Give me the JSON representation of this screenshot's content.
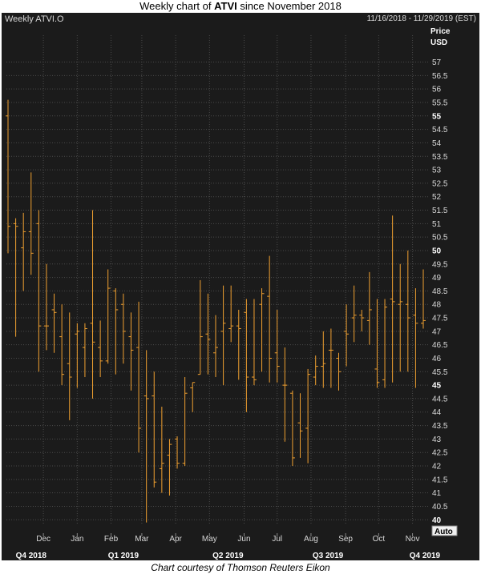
{
  "header": {
    "title_prefix": "Weekly chart of ",
    "title_ticker": "ATVI",
    "title_suffix": " since November 2018",
    "instrument": "Weekly ATVI.O",
    "date_range": "11/16/2018 - 11/29/2019 (EST)",
    "price_label": "Price",
    "currency_label": "USD",
    "scale_mode": "Auto",
    "credit": "Chart courtesy of Thomson Reuters Eikon"
  },
  "colors": {
    "background": "#1b1b1b",
    "bar": "#f0a030",
    "grid": "#4a4a4a",
    "text": "#d8d8d8"
  },
  "chart_data": {
    "type": "ohlc",
    "ylim": [
      39.8,
      57.7
    ],
    "grid": true,
    "yticks": [
      40,
      40.5,
      41,
      41.5,
      42,
      42.5,
      43,
      43.5,
      44,
      44.5,
      45,
      45.5,
      46,
      46.5,
      47,
      47.5,
      48,
      48.5,
      49,
      49.5,
      50,
      50.5,
      51,
      51.5,
      52,
      52.5,
      53,
      53.5,
      54,
      54.5,
      55,
      55.5,
      56,
      56.5,
      57
    ],
    "yticks_bold": [
      40,
      45,
      50,
      55
    ],
    "month_labels": [
      {
        "label": "Dec",
        "week": 4.6
      },
      {
        "label": "Jan",
        "week": 9.0
      },
      {
        "label": "Feb",
        "week": 13.4
      },
      {
        "label": "Mar",
        "week": 17.4
      },
      {
        "label": "Apr",
        "week": 21.8
      },
      {
        "label": "May",
        "week": 26.2
      },
      {
        "label": "Jun",
        "week": 30.7
      },
      {
        "label": "Jul",
        "week": 35.0
      },
      {
        "label": "Aug",
        "week": 39.4
      },
      {
        "label": "Sep",
        "week": 43.9
      },
      {
        "label": "Oct",
        "week": 48.2
      },
      {
        "label": "Nov",
        "week": 52.6
      }
    ],
    "quarter_labels": [
      {
        "label": "Q4 2018",
        "week": 3.0
      },
      {
        "label": "Q1 2019",
        "week": 15.0
      },
      {
        "label": "Q2 2019",
        "week": 28.6
      },
      {
        "label": "Q3 2019",
        "week": 41.6
      },
      {
        "label": "Q4 2019",
        "week": 54.2
      }
    ],
    "week_count": 55,
    "bars": [
      {
        "o": 55.0,
        "h": 55.6,
        "l": 49.9,
        "c": 50.9
      },
      {
        "o": 51.0,
        "h": 51.2,
        "l": 46.8,
        "c": 50.9
      },
      {
        "o": 50.1,
        "h": 51.4,
        "l": 48.5,
        "c": 50.7
      },
      {
        "o": 50.7,
        "h": 52.9,
        "l": 49.1,
        "c": 49.9
      },
      {
        "o": 51.0,
        "h": 51.5,
        "l": 45.5,
        "c": 47.2
      },
      {
        "o": 47.2,
        "h": 49.5,
        "l": 46.3,
        "c": 47.2
      },
      {
        "o": 47.8,
        "h": 48.4,
        "l": 46.2,
        "c": 47.7
      },
      {
        "o": 46.8,
        "h": 48.0,
        "l": 45.0,
        "c": 45.4
      },
      {
        "o": 45.8,
        "h": 47.7,
        "l": 43.7,
        "c": 45.3
      },
      {
        "o": 46.9,
        "h": 47.3,
        "l": 44.9,
        "c": 47.0
      },
      {
        "o": 46.4,
        "h": 47.3,
        "l": 45.3,
        "c": 47.1
      },
      {
        "o": 47.3,
        "h": 51.5,
        "l": 44.5,
        "c": 46.6
      },
      {
        "o": 46.4,
        "h": 47.4,
        "l": 45.3,
        "c": 45.9
      },
      {
        "o": 45.9,
        "h": 49.3,
        "l": 45.8,
        "c": 48.6
      },
      {
        "o": 48.5,
        "h": 48.6,
        "l": 45.4,
        "c": 47.8
      },
      {
        "o": 48.0,
        "h": 48.4,
        "l": 45.8,
        "c": 47.0
      },
      {
        "o": 46.8,
        "h": 47.7,
        "l": 44.8,
        "c": 46.3
      },
      {
        "o": 46.4,
        "h": 48.1,
        "l": 42.5,
        "c": 43.4
      },
      {
        "o": 44.6,
        "h": 46.3,
        "l": 39.9,
        "c": 44.5
      },
      {
        "o": 44.6,
        "h": 45.5,
        "l": 41.2,
        "c": 41.4
      },
      {
        "o": 41.9,
        "h": 44.2,
        "l": 41.0,
        "c": 42.1
      },
      {
        "o": 42.4,
        "h": 43.0,
        "l": 40.9,
        "c": 42.8
      },
      {
        "o": 43.0,
        "h": 43.1,
        "l": 41.9,
        "c": 42.1
      },
      {
        "o": 42.1,
        "h": 45.3,
        "l": 42.0,
        "c": 44.7
      },
      {
        "o": 44.9,
        "h": 45.1,
        "l": 44.0,
        "c": 45.1
      },
      {
        "o": 45.4,
        "h": 48.9,
        "l": 45.4,
        "c": 46.8
      },
      {
        "o": 46.9,
        "h": 48.4,
        "l": 45.4,
        "c": 46.7
      },
      {
        "o": 46.2,
        "h": 47.6,
        "l": 45.3,
        "c": 46.4
      },
      {
        "o": 47.0,
        "h": 48.7,
        "l": 45.0,
        "c": 47.3
      },
      {
        "o": 47.1,
        "h": 48.7,
        "l": 46.6,
        "c": 47.2
      },
      {
        "o": 47.2,
        "h": 47.8,
        "l": 45.2,
        "c": 47.1
      },
      {
        "o": 47.7,
        "h": 48.2,
        "l": 44.0,
        "c": 45.3
      },
      {
        "o": 45.3,
        "h": 48.2,
        "l": 45.0,
        "c": 45.2
      },
      {
        "o": 48.0,
        "h": 48.6,
        "l": 45.5,
        "c": 48.4
      },
      {
        "o": 48.3,
        "h": 49.8,
        "l": 45.1,
        "c": 46.0
      },
      {
        "o": 46.2,
        "h": 47.8,
        "l": 45.1,
        "c": 45.7
      },
      {
        "o": 45.0,
        "h": 46.4,
        "l": 42.9,
        "c": 45.0
      },
      {
        "o": 44.7,
        "h": 44.8,
        "l": 42.0,
        "c": 42.3
      },
      {
        "o": 43.6,
        "h": 44.7,
        "l": 42.3,
        "c": 43.3
      },
      {
        "o": 43.4,
        "h": 45.6,
        "l": 42.1,
        "c": 45.4
      },
      {
        "o": 45.3,
        "h": 46.1,
        "l": 45.0,
        "c": 45.7
      },
      {
        "o": 45.7,
        "h": 47.0,
        "l": 44.9,
        "c": 45.8
      },
      {
        "o": 46.3,
        "h": 47.1,
        "l": 44.9,
        "c": 46.3
      },
      {
        "o": 46.0,
        "h": 46.2,
        "l": 44.8,
        "c": 45.5
      },
      {
        "o": 47.0,
        "h": 48.0,
        "l": 45.7,
        "c": 46.9
      },
      {
        "o": 47.5,
        "h": 48.7,
        "l": 46.6,
        "c": 47.6
      },
      {
        "o": 47.6,
        "h": 47.8,
        "l": 47.0,
        "c": 47.5
      },
      {
        "o": 47.4,
        "h": 49.2,
        "l": 46.5,
        "c": 47.8
      },
      {
        "o": 45.6,
        "h": 48.2,
        "l": 44.9,
        "c": 45.1
      },
      {
        "o": 45.2,
        "h": 48.2,
        "l": 44.9,
        "c": 47.9
      },
      {
        "o": 48.2,
        "h": 51.3,
        "l": 45.1,
        "c": 48.1
      },
      {
        "o": 48.0,
        "h": 49.5,
        "l": 45.5,
        "c": 48.1
      },
      {
        "o": 48.0,
        "h": 50.0,
        "l": 45.5,
        "c": 47.5
      },
      {
        "o": 47.6,
        "h": 48.6,
        "l": 44.9,
        "c": 47.3
      },
      {
        "o": 47.3,
        "h": 49.3,
        "l": 47.1,
        "c": 47.4
      }
    ]
  }
}
